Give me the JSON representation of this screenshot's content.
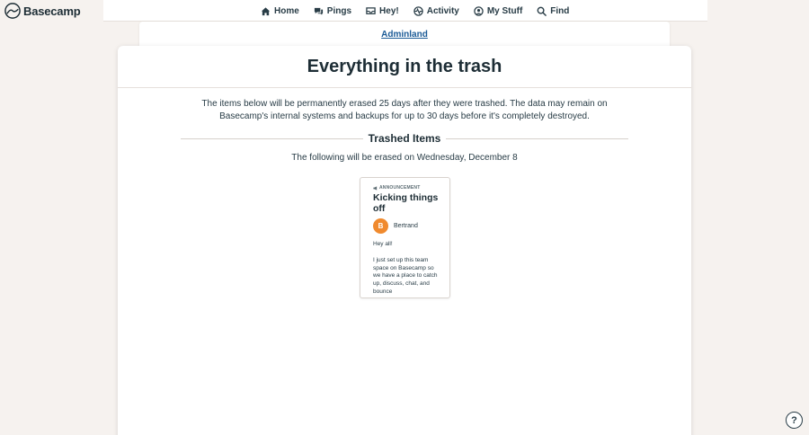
{
  "app": {
    "logo_text": "Basecamp"
  },
  "nav": [
    {
      "label": "Home",
      "icon": "home-icon"
    },
    {
      "label": "Pings",
      "icon": "pings-icon"
    },
    {
      "label": "Hey!",
      "icon": "hey-icon"
    },
    {
      "label": "Activity",
      "icon": "activity-icon"
    },
    {
      "label": "My Stuff",
      "icon": "my-stuff-icon"
    },
    {
      "label": "Find",
      "icon": "search-icon"
    }
  ],
  "breadcrumb": {
    "label": "Adminland"
  },
  "page": {
    "title": "Everything in the trash",
    "explanation": "The items below will be permanently erased 25 days after they were trashed. The data may remain on Basecamp's internal systems and backups for up to 30 days before it's completely destroyed.",
    "section_title": "Trashed Items",
    "following_text": "The following will be erased on Wednesday, December 8"
  },
  "trashed_items": [
    {
      "kind": "ANNOUNCEMENT",
      "title": "Kicking things off",
      "author": "Bertrand",
      "avatar_initial": "B",
      "body_greeting": "Hey all!",
      "body_text": "I just set up this team space on Basecamp so we have a place to catch up, discuss, chat, and bounce"
    }
  ],
  "help": {
    "label": "?"
  },
  "colors": {
    "accent": "#1a5a96",
    "avatar": "#f08a2e",
    "background": "#f6f2ef"
  }
}
